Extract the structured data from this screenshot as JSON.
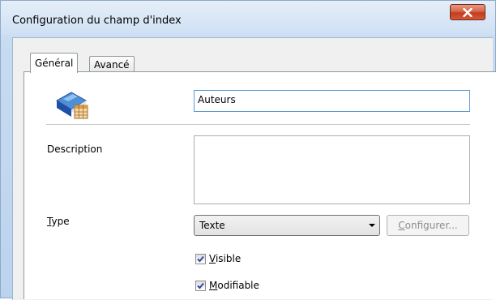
{
  "window": {
    "title": "Configuration du champ d'index",
    "close_symbol": "x"
  },
  "tabs": [
    {
      "label": "Général",
      "active": true
    },
    {
      "label": "Avancé",
      "active": false
    }
  ],
  "form": {
    "icon": "book-table-icon",
    "name_value": "Auteurs",
    "description_label": "Description",
    "description_value": "",
    "type_label_first": "T",
    "type_label_rest": "ype",
    "type_selected": "Texte",
    "configure_first": "C",
    "configure_rest": "onfigurer...",
    "visible_first": "V",
    "visible_rest": "isible",
    "visible_checked": true,
    "modifiable_first": "M",
    "modifiable_rest": "odifiable",
    "modifiable_checked": true
  },
  "colors": {
    "title_bar": "#cfe0f4",
    "close_button": "#c33d1d",
    "panel": "#ffffff",
    "focus_border": "#5b9bd5",
    "check_mark": "#2b4d9e"
  }
}
